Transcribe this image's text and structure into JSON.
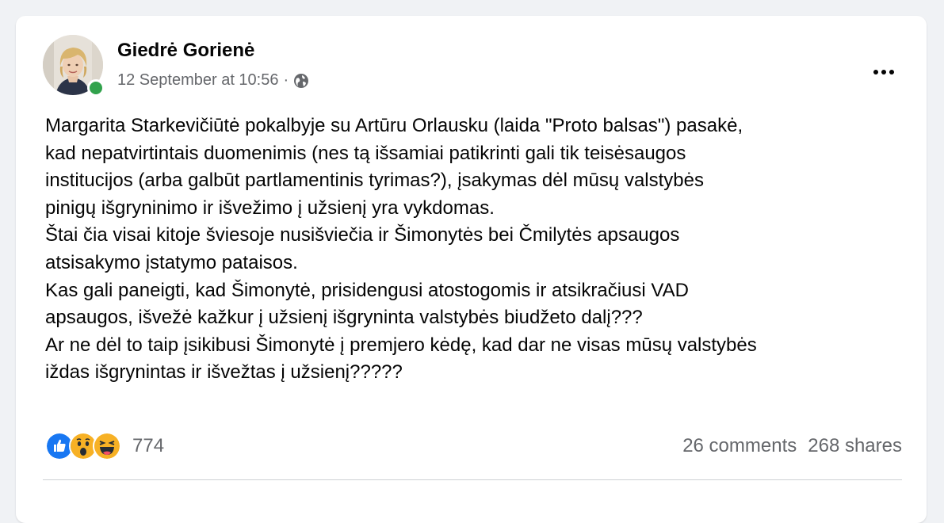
{
  "post": {
    "author": "Giedrė Gorienė",
    "timestamp": "12 September at 10:56",
    "separator": "·",
    "privacy_icon": "globe-icon",
    "more_icon": "more-options-icon",
    "online": true,
    "text_lines": [
      "Margarita Starkevičiūtė pokalbyje su Artūru Orlausku (laida \"Proto balsas\") pasakė,",
      "kad nepatvirtintais duomenimis (nes tą išsamiai patikrinti gali tik teisėsaugos",
      "institucijos (arba galbūt partlamentinis tyrimas?), įsakymas dėl mūsų valstybės",
      "pinigų išgryninimo ir išvežimo į užsienį yra vykdomas.",
      "Štai čia visai kitoje šviesoje nusišviečia ir Šimonytės bei Čmilytės apsaugos",
      "atsisakymo įstatymo pataisos.",
      "Kas gali paneigti, kad Šimonytė, prisidengusi atostogomis ir atsikračiusi VAD",
      "apsaugos, išvežė kažkur į užsienį išgryninta valstybės biudžeto dalį???",
      "Ar ne dėl to taip įsikibusi Šimonytė į premjero kėdę, kad dar ne visas mūsų valstybės",
      "iždas išgrynintas ir išvežtas į užsienį?????"
    ]
  },
  "footer": {
    "reactions": [
      "like-icon",
      "wow-icon",
      "haha-icon"
    ],
    "reaction_count": "774",
    "comments": "26 comments",
    "shares": "268 shares"
  },
  "colors": {
    "online": "#31a24c",
    "like": "#1877f2",
    "emoji": "#f7b125",
    "secondary_text": "#65676b"
  }
}
